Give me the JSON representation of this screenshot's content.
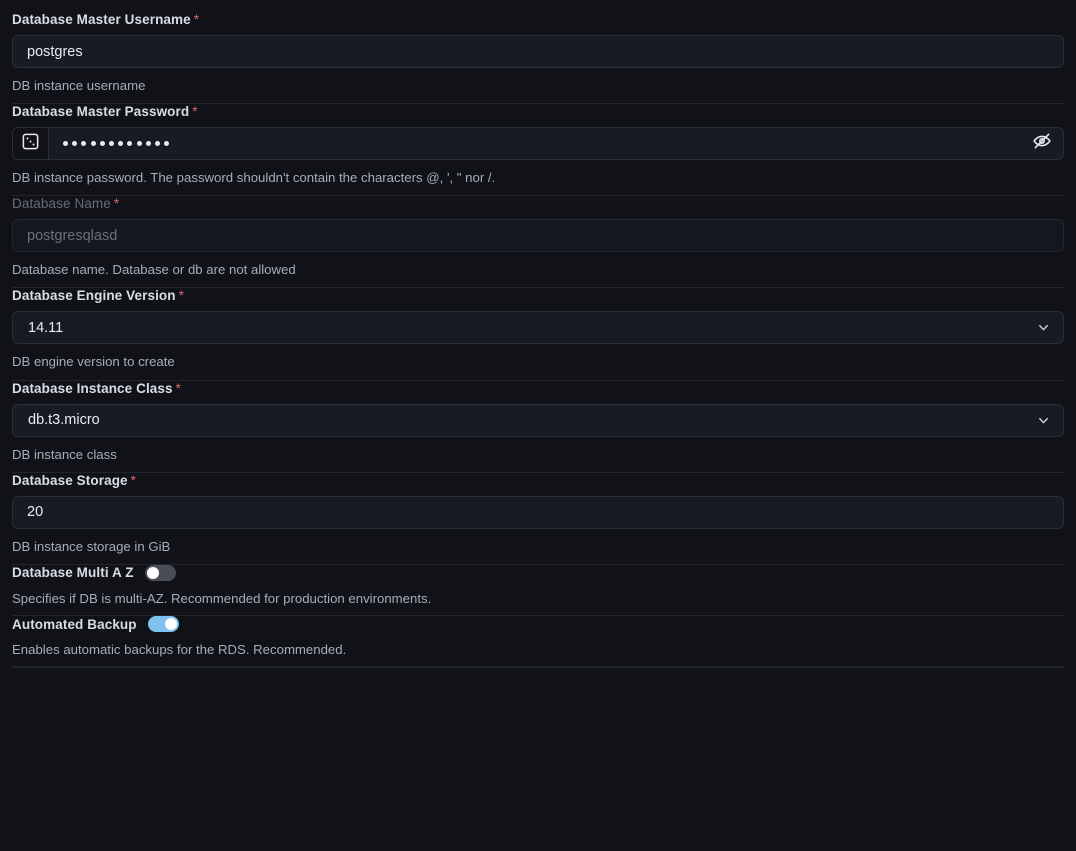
{
  "form": {
    "required_marker": "*",
    "fields": [
      {
        "name": "database-master-username",
        "label": "Database Master Username",
        "required": true,
        "type": "text",
        "value": "postgres",
        "help": "DB instance username",
        "disabled": false
      },
      {
        "name": "database-master-password",
        "label": "Database Master Password",
        "required": true,
        "type": "password",
        "value": "••••••••••••",
        "masked_char_count": 12,
        "help": "DB instance password. The password shouldn't contain the characters @, ', \" nor /.",
        "disabled": false,
        "generate_icon": "dice-icon",
        "reveal_icon": "eye-off-icon"
      },
      {
        "name": "database-name",
        "label": "Database Name",
        "required": true,
        "type": "text",
        "value": "postgresqlasd",
        "help": "Database name. Database or db are not allowed",
        "disabled": true
      },
      {
        "name": "database-engine-version",
        "label": "Database Engine Version",
        "required": true,
        "type": "select",
        "value": "14.11",
        "help": "DB engine version to create",
        "disabled": false,
        "chevron_icon": "chevron-down-icon"
      },
      {
        "name": "database-instance-class",
        "label": "Database Instance Class",
        "required": true,
        "type": "select",
        "value": "db.t3.micro",
        "help": "DB instance class",
        "disabled": false,
        "chevron_icon": "chevron-down-icon"
      },
      {
        "name": "database-storage",
        "label": "Database Storage",
        "required": true,
        "type": "text",
        "value": "20",
        "help": "DB instance storage in GiB",
        "disabled": false
      },
      {
        "name": "database-multi-a-z",
        "label": "Database Multi A Z",
        "required": false,
        "type": "toggle",
        "checked": false,
        "help": "Specifies if DB is multi-AZ. Recommended for production environments."
      },
      {
        "name": "automated-backup",
        "label": "Automated Backup",
        "required": false,
        "type": "toggle",
        "checked": true,
        "help": "Enables automatic backups for the RDS. Recommended."
      }
    ]
  },
  "colors": {
    "page_background": "#111217",
    "input_background": "#181b24",
    "input_border": "#2b2f3c",
    "label_text": "#d8dde6",
    "help_text": "#a4adbd",
    "required_asterisk": "#e0676c",
    "toggle_on": "#7fc2ef",
    "toggle_off": "#4a4d57",
    "divider": "#23252e"
  }
}
